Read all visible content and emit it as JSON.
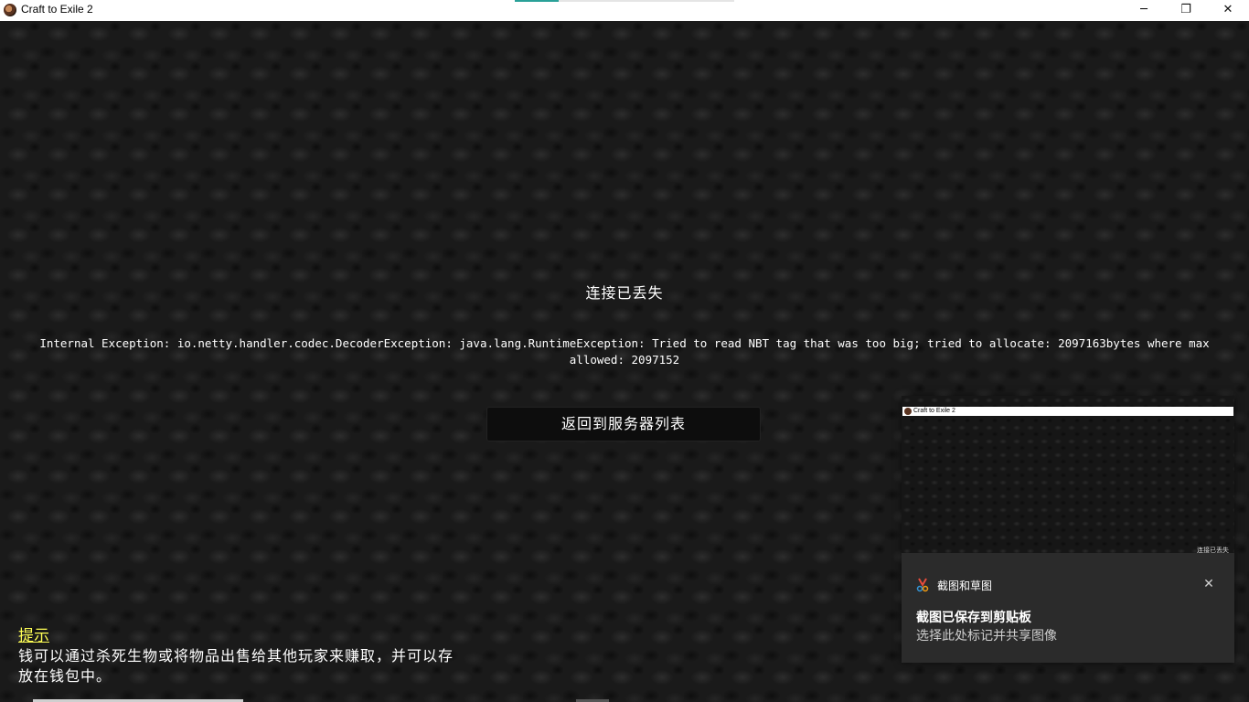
{
  "window": {
    "title": "Craft to Exile 2",
    "controls": {
      "minimize": "─",
      "maximize": "❐",
      "close": "✕"
    },
    "title_progress": 0.2
  },
  "game": {
    "disconnect_title": "连接已丢失",
    "disconnect_reason": "Internal Exception: io.netty.handler.codec.DecoderException: java.lang.RuntimeException: Tried to read NBT tag that was too big; tried to allocate: 2097163bytes where max allowed: 2097152",
    "back_button": "返回到服务器列表",
    "tip_label": "提示",
    "tip_text": "钱可以通过杀死生物或将物品出售给其他玩家来赚取，并可以存放在钱包中。"
  },
  "notification": {
    "preview_title": "Craft to Exile 2",
    "preview_snippet": "连接已丢失",
    "app_name": "截图和草图",
    "close_glyph": "✕",
    "heading": "截图已保存到剪贴板",
    "body": "选择此处标记并共享图像"
  },
  "colors": {
    "tip_label": "#ffff55",
    "progress_accent": "#2aa198",
    "notification_bg": "#2b2b2b"
  }
}
